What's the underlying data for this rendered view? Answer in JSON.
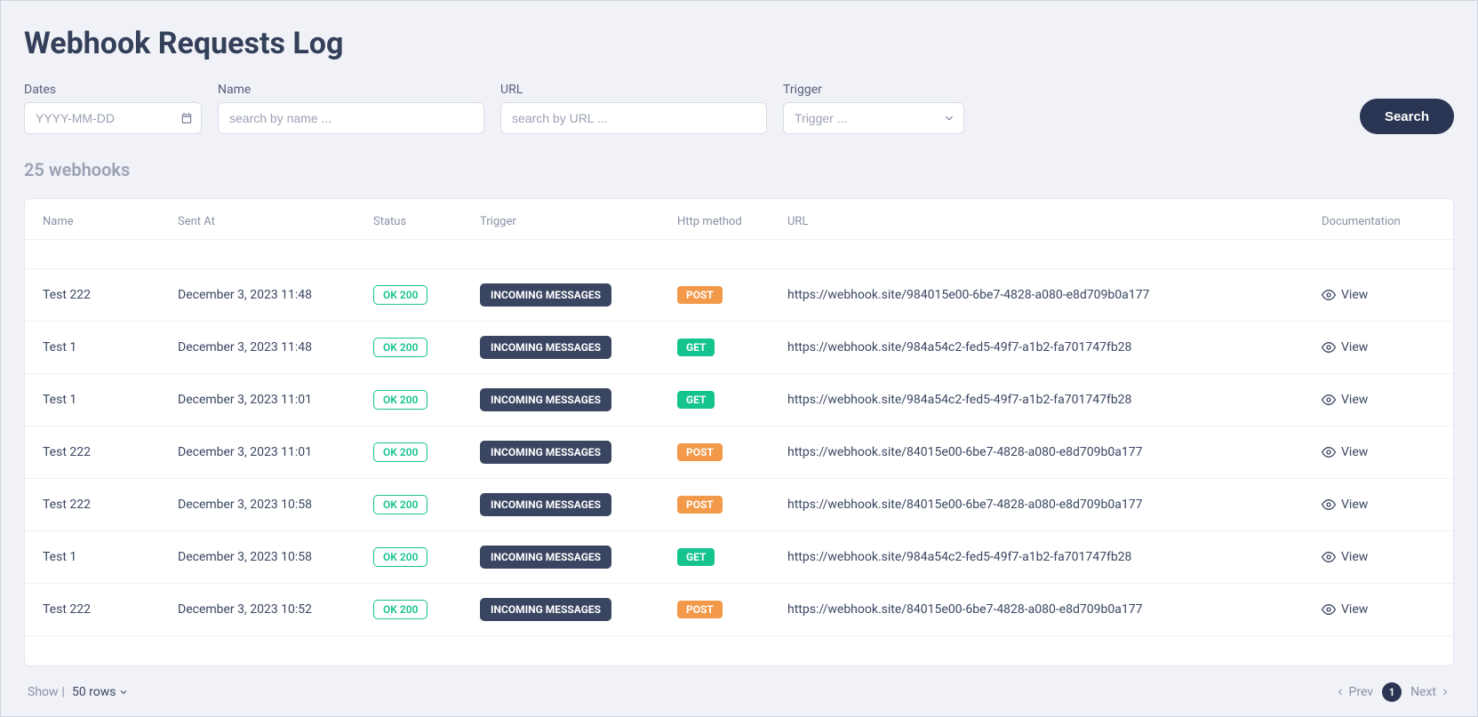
{
  "page": {
    "title": "Webhook Requests Log",
    "count_text": "25 webhooks"
  },
  "filters": {
    "dates": {
      "label": "Dates",
      "placeholder": "YYYY-MM-DD",
      "value": ""
    },
    "name": {
      "label": "Name",
      "placeholder": "search by name ...",
      "value": ""
    },
    "url": {
      "label": "URL",
      "placeholder": "search by URL ...",
      "value": ""
    },
    "trigger": {
      "label": "Trigger",
      "placeholder": "Trigger ...",
      "value": ""
    },
    "search_label": "Search"
  },
  "columns": {
    "name": "Name",
    "sent_at": "Sent At",
    "status": "Status",
    "trigger": "Trigger",
    "http_method": "Http method",
    "url": "URL",
    "documentation": "Documentation"
  },
  "view_label": "View",
  "rows": [
    {
      "name": "Test 222",
      "sent_at": "December 3, 2023 11:48",
      "status": "OK 200",
      "trigger": "INCOMING MESSAGES",
      "method": "POST",
      "url": "https://webhook.site/984015e00-6be7-4828-a080-e8d709b0a177"
    },
    {
      "name": "Test 1",
      "sent_at": "December 3, 2023 11:48",
      "status": "OK 200",
      "trigger": "INCOMING MESSAGES",
      "method": "GET",
      "url": "https://webhook.site/984a54c2-fed5-49f7-a1b2-fa701747fb28"
    },
    {
      "name": "Test 1",
      "sent_at": "December 3, 2023 11:01",
      "status": "OK 200",
      "trigger": "INCOMING MESSAGES",
      "method": "GET",
      "url": "https://webhook.site/984a54c2-fed5-49f7-a1b2-fa701747fb28"
    },
    {
      "name": "Test 222",
      "sent_at": "December 3, 2023 11:01",
      "status": "OK 200",
      "trigger": "INCOMING MESSAGES",
      "method": "POST",
      "url": "https://webhook.site/84015e00-6be7-4828-a080-e8d709b0a177"
    },
    {
      "name": "Test 222",
      "sent_at": "December 3, 2023 10:58",
      "status": "OK 200",
      "trigger": "INCOMING MESSAGES",
      "method": "POST",
      "url": "https://webhook.site/84015e00-6be7-4828-a080-e8d709b0a177"
    },
    {
      "name": "Test 1",
      "sent_at": "December 3, 2023 10:58",
      "status": "OK 200",
      "trigger": "INCOMING MESSAGES",
      "method": "GET",
      "url": "https://webhook.site/984a54c2-fed5-49f7-a1b2-fa701747fb28"
    },
    {
      "name": "Test 222",
      "sent_at": "December 3, 2023 10:52",
      "status": "OK 200",
      "trigger": "INCOMING MESSAGES",
      "method": "POST",
      "url": "https://webhook.site/84015e00-6be7-4828-a080-e8d709b0a177"
    }
  ],
  "footer": {
    "show_label": "Show",
    "rows_label": "50 rows",
    "prev_label": "Prev",
    "next_label": "Next",
    "current_page": "1"
  }
}
